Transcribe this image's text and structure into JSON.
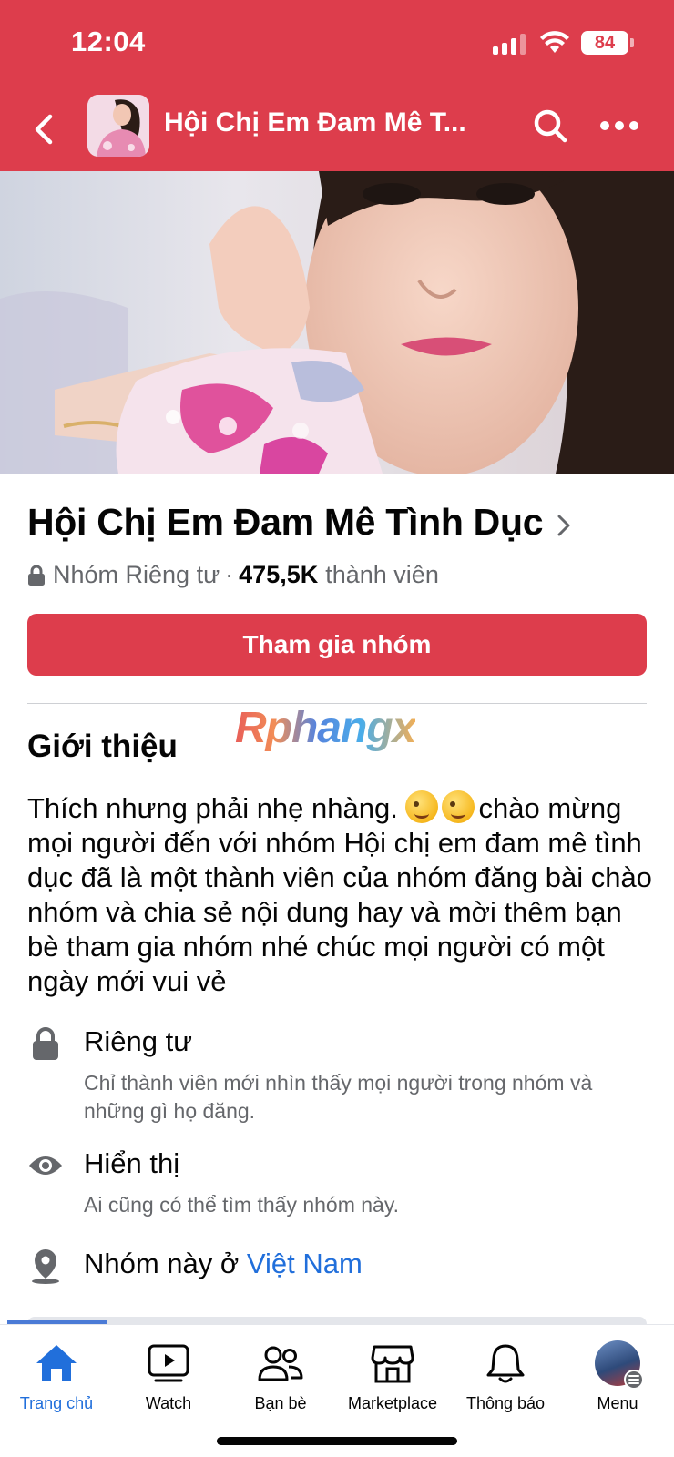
{
  "status_bar": {
    "time": "12:04",
    "battery": "84"
  },
  "nav": {
    "title": "Hội Chị Em Đam Mê T..."
  },
  "group": {
    "name": "Hội Chị Em Đam Mê Tình Dục",
    "privacy": "Nhóm Riêng tư",
    "separator": "·",
    "member_count": "475,5K",
    "member_label": "thành viên",
    "join_label": "Tham gia nhóm"
  },
  "watermark": "Rphangx",
  "about": {
    "heading": "Giới thiệu",
    "description_start": "Thích nhưng phải nhẹ nhàng.",
    "description_rest": "chào mừng mọi người đến với nhóm Hội chị em đam mê tình dục đã là một thành viên của nhóm đăng bài chào nhóm và chia sẻ nội dung hay và mời thêm bạn bè tham gia nhóm nhé chúc mọi người có một ngày mới vui vẻ",
    "items": [
      {
        "icon": "lock-icon",
        "title": "Riêng tư",
        "desc": "Chỉ thành viên mới nhìn thấy mọi người trong nhóm và những gì họ đăng."
      },
      {
        "icon": "eye-icon",
        "title": "Hiển thị",
        "desc": "Ai cũng có thể tìm thấy nhóm này."
      }
    ],
    "location_prefix": "Nhóm này ở",
    "location_link": "Việt Nam"
  },
  "tabs": [
    {
      "label": "Trang chủ",
      "icon": "home-icon",
      "active": true
    },
    {
      "label": "Watch",
      "icon": "watch-icon"
    },
    {
      "label": "Bạn bè",
      "icon": "friends-icon"
    },
    {
      "label": "Marketplace",
      "icon": "marketplace-icon"
    },
    {
      "label": "Thông báo",
      "icon": "bell-icon"
    },
    {
      "label": "Menu",
      "icon": "avatar"
    }
  ],
  "colors": {
    "brand_red": "#dd3d4c",
    "link_blue": "#216fdb",
    "secondary_text": "#65676b"
  }
}
